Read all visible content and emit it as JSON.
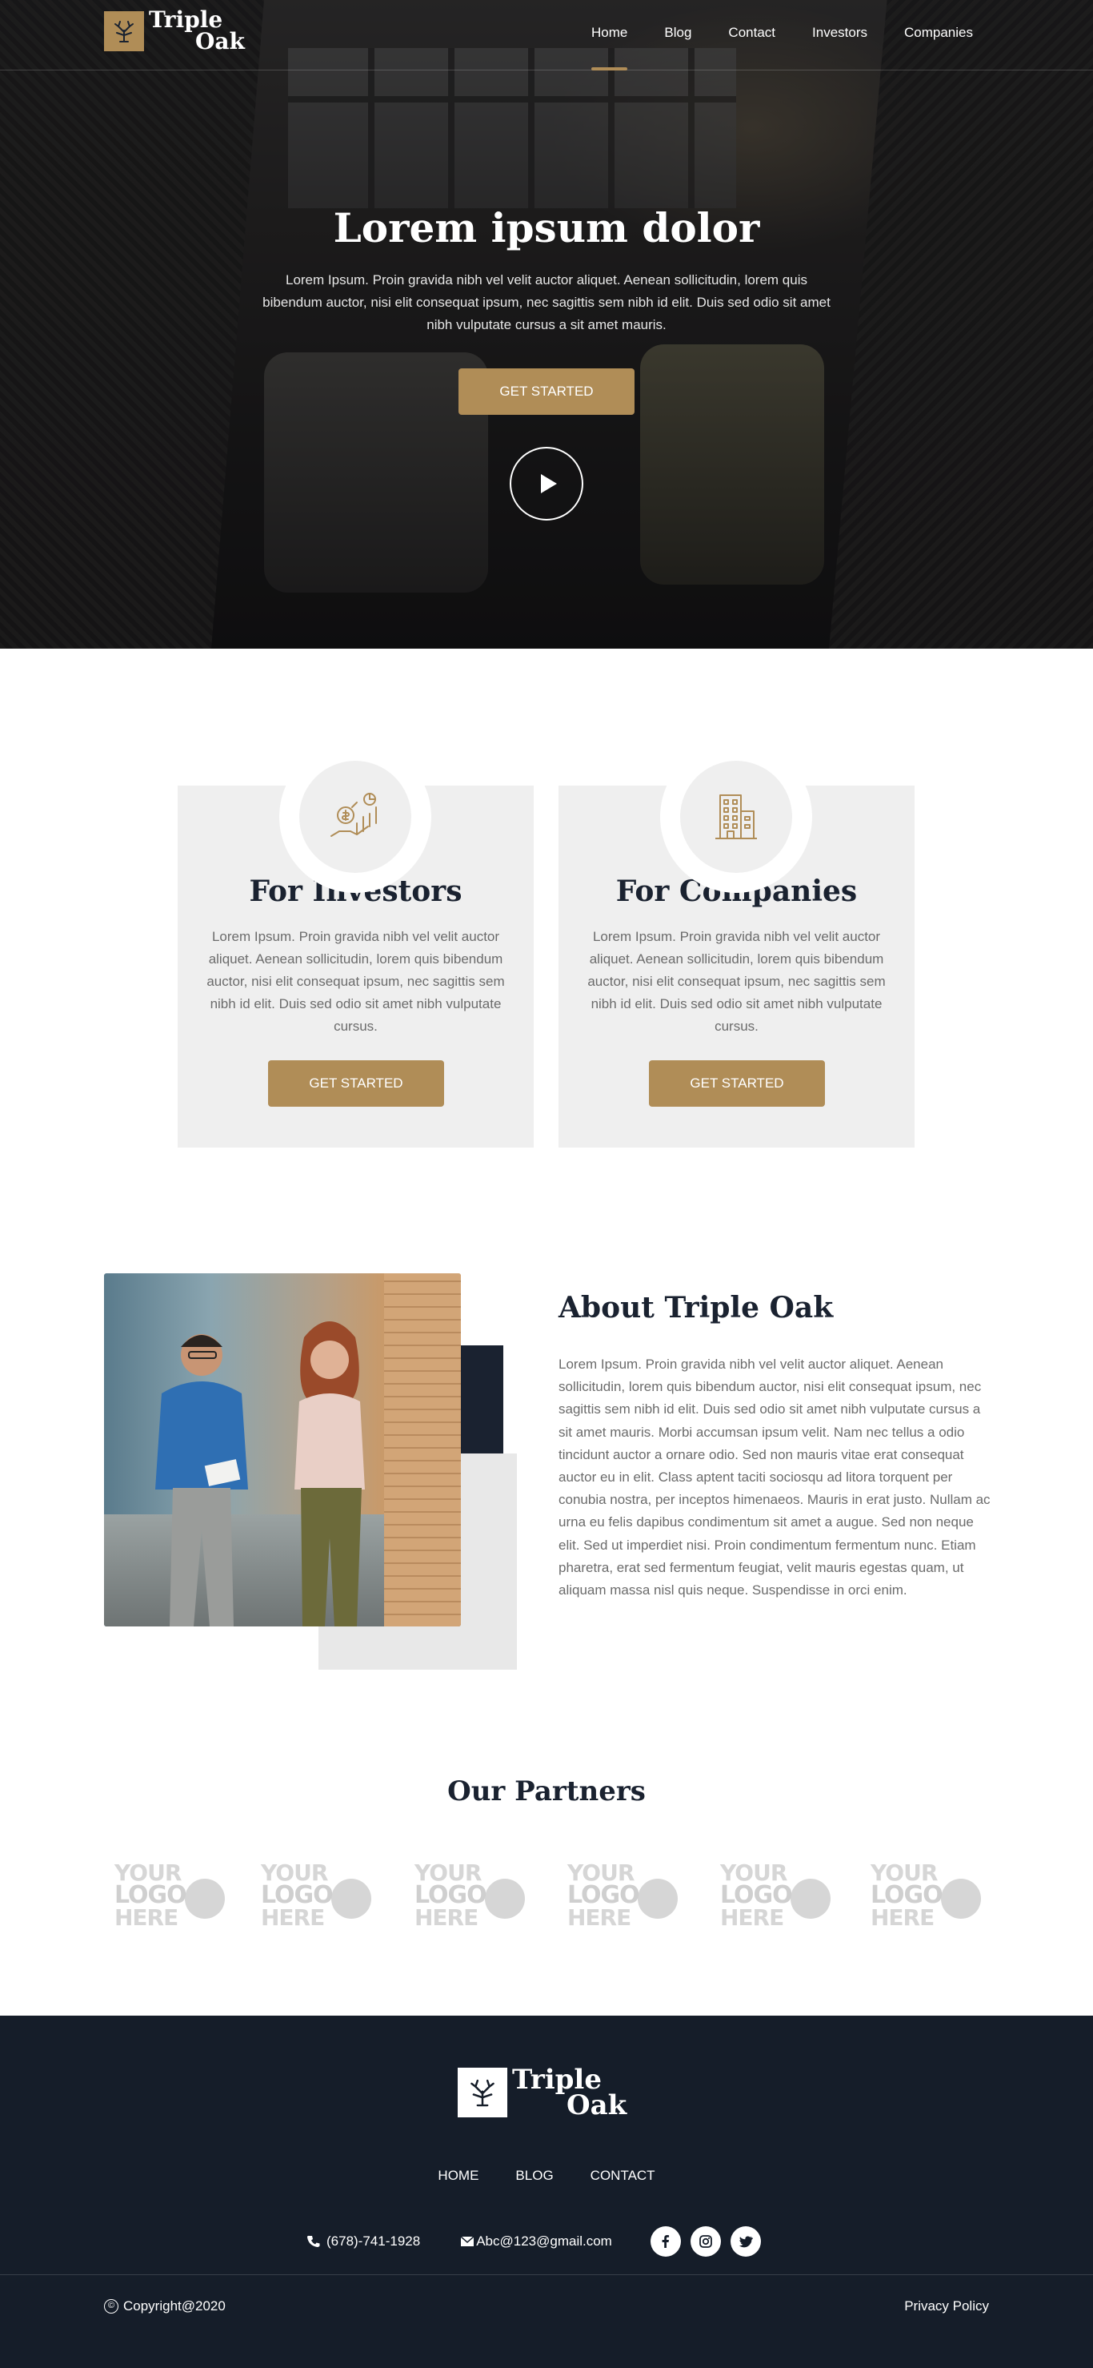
{
  "brand": {
    "name_line1": "Triple",
    "name_line2": "Oak",
    "accent": "#b08d57",
    "dark": "#151d29"
  },
  "nav": {
    "items": [
      {
        "label": "Home",
        "active": true
      },
      {
        "label": "Blog",
        "active": false
      },
      {
        "label": "Contact",
        "active": false
      },
      {
        "label": "Investors",
        "active": false
      },
      {
        "label": "Companies",
        "active": false
      }
    ]
  },
  "hero": {
    "title": "Lorem ipsum dolor",
    "text": "Lorem Ipsum. Proin gravida nibh vel velit auctor aliquet. Aenean sollicitudin, lorem quis bibendum auctor, nisi elit consequat ipsum, nec sagittis sem nibh id elit. Duis sed odio sit amet nibh vulputate cursus a sit amet mauris.",
    "cta": "GET STARTED",
    "play_icon": "play-icon"
  },
  "cards": [
    {
      "icon": "investor-growth-icon",
      "title": "For Investors",
      "text": "Lorem Ipsum. Proin gravida nibh vel velit auctor aliquet. Aenean sollicitudin, lorem quis bibendum auctor, nisi elit consequat ipsum, nec sagittis sem nibh id elit. Duis sed odio sit amet nibh vulputate cursus.",
      "cta": "GET STARTED"
    },
    {
      "icon": "building-icon",
      "title": "For Companies",
      "text": "Lorem Ipsum. Proin gravida nibh vel velit auctor aliquet. Aenean sollicitudin, lorem quis bibendum auctor, nisi elit consequat ipsum, nec sagittis sem nibh id elit. Duis sed odio sit amet nibh vulputate cursus.",
      "cta": "GET STARTED"
    }
  ],
  "about": {
    "title": "About Triple Oak",
    "text": "Lorem Ipsum. Proin gravida nibh vel velit auctor aliquet. Aenean sollicitudin, lorem quis bibendum auctor, nisi elit consequat ipsum, nec sagittis sem nibh id elit. Duis sed odio sit amet nibh vulputate cursus a sit amet mauris. Morbi accumsan ipsum velit. Nam nec tellus a odio tincidunt auctor a ornare odio. Sed non mauris vitae erat consequat auctor eu in elit. Class aptent taciti sociosqu ad litora torquent per conubia nostra, per inceptos himenaeos. Mauris in erat justo. Nullam ac urna eu felis dapibus condimentum sit amet a augue. Sed non neque elit. Sed ut imperdiet nisi. Proin condimentum fermentum nunc. Etiam pharetra, erat sed fermentum feugiat, velit mauris egestas quam, ut aliquam massa nisl quis neque. Suspendisse in orci enim."
  },
  "partners": {
    "title": "Our Partners",
    "logos": [
      {
        "l1": "YOUR",
        "l2": "LOGO",
        "l3": "HERE"
      },
      {
        "l1": "YOUR",
        "l2": "LOGO",
        "l3": "HERE"
      },
      {
        "l1": "YOUR",
        "l2": "LOGO",
        "l3": "HERE"
      },
      {
        "l1": "YOUR",
        "l2": "LOGO",
        "l3": "HERE"
      },
      {
        "l1": "YOUR",
        "l2": "LOGO",
        "l3": "HERE"
      },
      {
        "l1": "YOUR",
        "l2": "LOGO",
        "l3": "HERE"
      }
    ]
  },
  "footer": {
    "nav": [
      "HOME",
      "BLOG",
      "CONTACT"
    ],
    "phone": "(678)-741-1928",
    "email": "Abc@123@gmail.com",
    "socials": [
      "facebook-icon",
      "instagram-icon",
      "twitter-icon"
    ],
    "copyright": "Copyright@2020",
    "privacy": "Privacy Policy"
  }
}
